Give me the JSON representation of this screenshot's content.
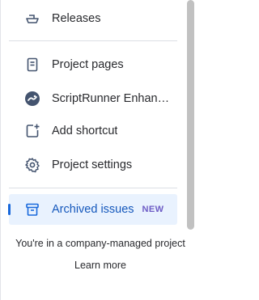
{
  "nav": {
    "releases": {
      "label": "Releases",
      "icon": "ship-icon"
    },
    "project_pages": {
      "label": "Project pages",
      "icon": "document-icon"
    },
    "scriptrunner": {
      "label": "ScriptRunner Enhanc…",
      "icon": "scriptrunner-logo-icon"
    },
    "add_shortcut": {
      "label": "Add shortcut",
      "icon": "add-shortcut-icon"
    },
    "project_settings": {
      "label": "Project settings",
      "icon": "gear-icon"
    },
    "archived_issues": {
      "label": "Archived issues",
      "badge": "NEW",
      "icon": "archive-icon"
    }
  },
  "footer": {
    "managed_text": "You're in a company-managed project",
    "learn_more": "Learn more"
  },
  "colors": {
    "active_bg": "#e9f2fe",
    "active_text": "#1558bc",
    "badge": "#6e5dc6",
    "text": "#292a2e"
  }
}
